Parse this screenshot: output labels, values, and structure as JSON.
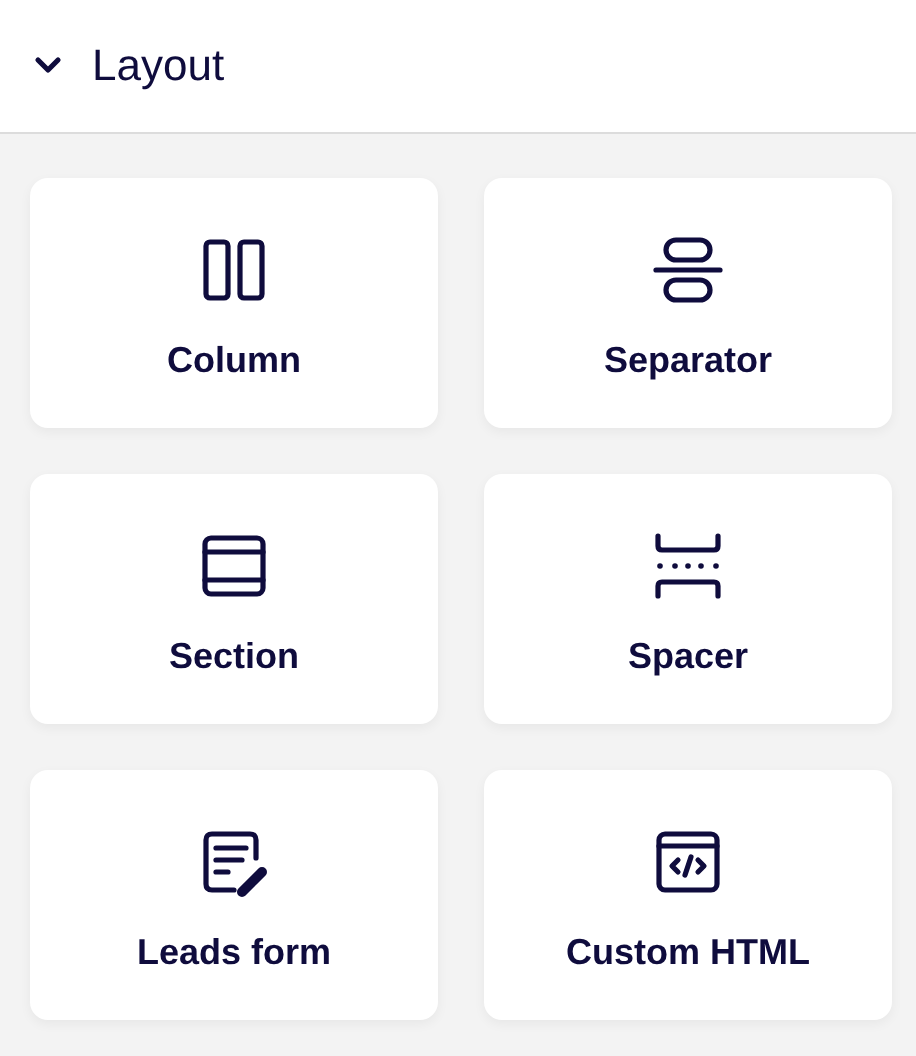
{
  "panel": {
    "title": "Layout",
    "expanded": true
  },
  "blocks": [
    {
      "label": "Column",
      "kind": "column"
    },
    {
      "label": "Separator",
      "kind": "separator"
    },
    {
      "label": "Section",
      "kind": "section"
    },
    {
      "label": "Spacer",
      "kind": "spacer"
    },
    {
      "label": "Leads form",
      "kind": "form"
    },
    {
      "label": "Custom HTML",
      "kind": "html"
    }
  ]
}
